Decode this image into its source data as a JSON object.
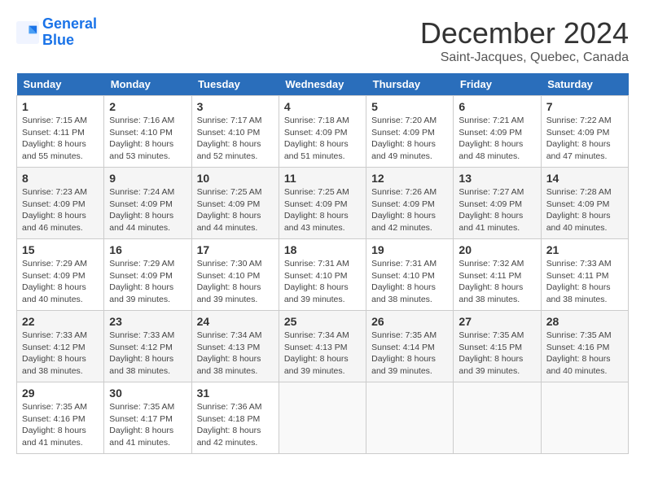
{
  "logo": {
    "line1": "General",
    "line2": "Blue"
  },
  "title": "December 2024",
  "subtitle": "Saint-Jacques, Quebec, Canada",
  "days_of_week": [
    "Sunday",
    "Monday",
    "Tuesday",
    "Wednesday",
    "Thursday",
    "Friday",
    "Saturday"
  ],
  "weeks": [
    [
      {
        "day": "1",
        "sunrise": "Sunrise: 7:15 AM",
        "sunset": "Sunset: 4:11 PM",
        "daylight": "Daylight: 8 hours and 55 minutes."
      },
      {
        "day": "2",
        "sunrise": "Sunrise: 7:16 AM",
        "sunset": "Sunset: 4:10 PM",
        "daylight": "Daylight: 8 hours and 53 minutes."
      },
      {
        "day": "3",
        "sunrise": "Sunrise: 7:17 AM",
        "sunset": "Sunset: 4:10 PM",
        "daylight": "Daylight: 8 hours and 52 minutes."
      },
      {
        "day": "4",
        "sunrise": "Sunrise: 7:18 AM",
        "sunset": "Sunset: 4:09 PM",
        "daylight": "Daylight: 8 hours and 51 minutes."
      },
      {
        "day": "5",
        "sunrise": "Sunrise: 7:20 AM",
        "sunset": "Sunset: 4:09 PM",
        "daylight": "Daylight: 8 hours and 49 minutes."
      },
      {
        "day": "6",
        "sunrise": "Sunrise: 7:21 AM",
        "sunset": "Sunset: 4:09 PM",
        "daylight": "Daylight: 8 hours and 48 minutes."
      },
      {
        "day": "7",
        "sunrise": "Sunrise: 7:22 AM",
        "sunset": "Sunset: 4:09 PM",
        "daylight": "Daylight: 8 hours and 47 minutes."
      }
    ],
    [
      {
        "day": "8",
        "sunrise": "Sunrise: 7:23 AM",
        "sunset": "Sunset: 4:09 PM",
        "daylight": "Daylight: 8 hours and 46 minutes."
      },
      {
        "day": "9",
        "sunrise": "Sunrise: 7:24 AM",
        "sunset": "Sunset: 4:09 PM",
        "daylight": "Daylight: 8 hours and 44 minutes."
      },
      {
        "day": "10",
        "sunrise": "Sunrise: 7:25 AM",
        "sunset": "Sunset: 4:09 PM",
        "daylight": "Daylight: 8 hours and 44 minutes."
      },
      {
        "day": "11",
        "sunrise": "Sunrise: 7:25 AM",
        "sunset": "Sunset: 4:09 PM",
        "daylight": "Daylight: 8 hours and 43 minutes."
      },
      {
        "day": "12",
        "sunrise": "Sunrise: 7:26 AM",
        "sunset": "Sunset: 4:09 PM",
        "daylight": "Daylight: 8 hours and 42 minutes."
      },
      {
        "day": "13",
        "sunrise": "Sunrise: 7:27 AM",
        "sunset": "Sunset: 4:09 PM",
        "daylight": "Daylight: 8 hours and 41 minutes."
      },
      {
        "day": "14",
        "sunrise": "Sunrise: 7:28 AM",
        "sunset": "Sunset: 4:09 PM",
        "daylight": "Daylight: 8 hours and 40 minutes."
      }
    ],
    [
      {
        "day": "15",
        "sunrise": "Sunrise: 7:29 AM",
        "sunset": "Sunset: 4:09 PM",
        "daylight": "Daylight: 8 hours and 40 minutes."
      },
      {
        "day": "16",
        "sunrise": "Sunrise: 7:29 AM",
        "sunset": "Sunset: 4:09 PM",
        "daylight": "Daylight: 8 hours and 39 minutes."
      },
      {
        "day": "17",
        "sunrise": "Sunrise: 7:30 AM",
        "sunset": "Sunset: 4:10 PM",
        "daylight": "Daylight: 8 hours and 39 minutes."
      },
      {
        "day": "18",
        "sunrise": "Sunrise: 7:31 AM",
        "sunset": "Sunset: 4:10 PM",
        "daylight": "Daylight: 8 hours and 39 minutes."
      },
      {
        "day": "19",
        "sunrise": "Sunrise: 7:31 AM",
        "sunset": "Sunset: 4:10 PM",
        "daylight": "Daylight: 8 hours and 38 minutes."
      },
      {
        "day": "20",
        "sunrise": "Sunrise: 7:32 AM",
        "sunset": "Sunset: 4:11 PM",
        "daylight": "Daylight: 8 hours and 38 minutes."
      },
      {
        "day": "21",
        "sunrise": "Sunrise: 7:33 AM",
        "sunset": "Sunset: 4:11 PM",
        "daylight": "Daylight: 8 hours and 38 minutes."
      }
    ],
    [
      {
        "day": "22",
        "sunrise": "Sunrise: 7:33 AM",
        "sunset": "Sunset: 4:12 PM",
        "daylight": "Daylight: 8 hours and 38 minutes."
      },
      {
        "day": "23",
        "sunrise": "Sunrise: 7:33 AM",
        "sunset": "Sunset: 4:12 PM",
        "daylight": "Daylight: 8 hours and 38 minutes."
      },
      {
        "day": "24",
        "sunrise": "Sunrise: 7:34 AM",
        "sunset": "Sunset: 4:13 PM",
        "daylight": "Daylight: 8 hours and 38 minutes."
      },
      {
        "day": "25",
        "sunrise": "Sunrise: 7:34 AM",
        "sunset": "Sunset: 4:13 PM",
        "daylight": "Daylight: 8 hours and 39 minutes."
      },
      {
        "day": "26",
        "sunrise": "Sunrise: 7:35 AM",
        "sunset": "Sunset: 4:14 PM",
        "daylight": "Daylight: 8 hours and 39 minutes."
      },
      {
        "day": "27",
        "sunrise": "Sunrise: 7:35 AM",
        "sunset": "Sunset: 4:15 PM",
        "daylight": "Daylight: 8 hours and 39 minutes."
      },
      {
        "day": "28",
        "sunrise": "Sunrise: 7:35 AM",
        "sunset": "Sunset: 4:16 PM",
        "daylight": "Daylight: 8 hours and 40 minutes."
      }
    ],
    [
      {
        "day": "29",
        "sunrise": "Sunrise: 7:35 AM",
        "sunset": "Sunset: 4:16 PM",
        "daylight": "Daylight: 8 hours and 41 minutes."
      },
      {
        "day": "30",
        "sunrise": "Sunrise: 7:35 AM",
        "sunset": "Sunset: 4:17 PM",
        "daylight": "Daylight: 8 hours and 41 minutes."
      },
      {
        "day": "31",
        "sunrise": "Sunrise: 7:36 AM",
        "sunset": "Sunset: 4:18 PM",
        "daylight": "Daylight: 8 hours and 42 minutes."
      },
      null,
      null,
      null,
      null
    ]
  ]
}
